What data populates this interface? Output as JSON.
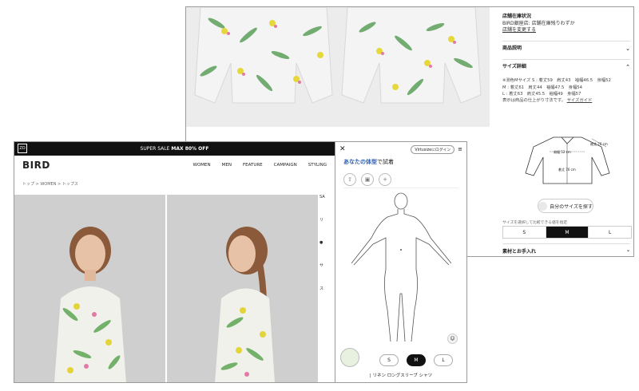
{
  "back": {
    "stock_label": "店舗在庫状況",
    "stock_value": "BIRD銀座店: 店舗在庫残りわずか",
    "store_link": "店舗を変更する",
    "sections": {
      "description": "商品説明",
      "size_detail": "サイズ詳細",
      "material": "素材とお手入れ"
    },
    "size_lines": [
      "※测色Mサイズ S : 着丈59　肩丈43　袖幅46.5　身幅52",
      "M : 着丈61　肩丈44　袖幅47.5　身幅54",
      "L : 着丈63　肩丈45.5　袖幅49　身幅57"
    ],
    "size_note": "表示は商品の仕上がり寸法です。",
    "size_guide": "サイズガイド",
    "diagram_labels": {
      "shoulder": "肩幅 52 cm",
      "length": "着丈 76 cm",
      "sleeve": "袖丈 76 cm"
    },
    "fit_button": "自分のサイズを探す",
    "hint": "サイズを選択して比較できる値を指定",
    "size_options": [
      "S",
      "M",
      "L"
    ],
    "selected_size": "M"
  },
  "front": {
    "logo_mark": "ZO",
    "promo_prefix": "SUPER SALE",
    "promo_bold": "MAX 80% OFF",
    "brand": "BIRD",
    "menu": [
      "WOMEN",
      "MEN",
      "FEATURE",
      "CAMPAIGN",
      "STYLING"
    ],
    "breadcrumb": "トップ > WOMEN > トップス",
    "side_fragments": [
      "SA",
      "リ",
      "●",
      "",
      "サ",
      "ス"
    ]
  },
  "vs": {
    "login": "Virtusizeにログイン",
    "title_prefix": "あなたの体型",
    "title_suffix": "で試着",
    "sizes": [
      "S",
      "M",
      "L"
    ],
    "selected": "M",
    "product_name": "| リネン ロングスリーブ シャツ"
  },
  "colors": {
    "accent": "#2a5db0",
    "dark": "#111111",
    "panel_bg": "#cfcfcf"
  }
}
